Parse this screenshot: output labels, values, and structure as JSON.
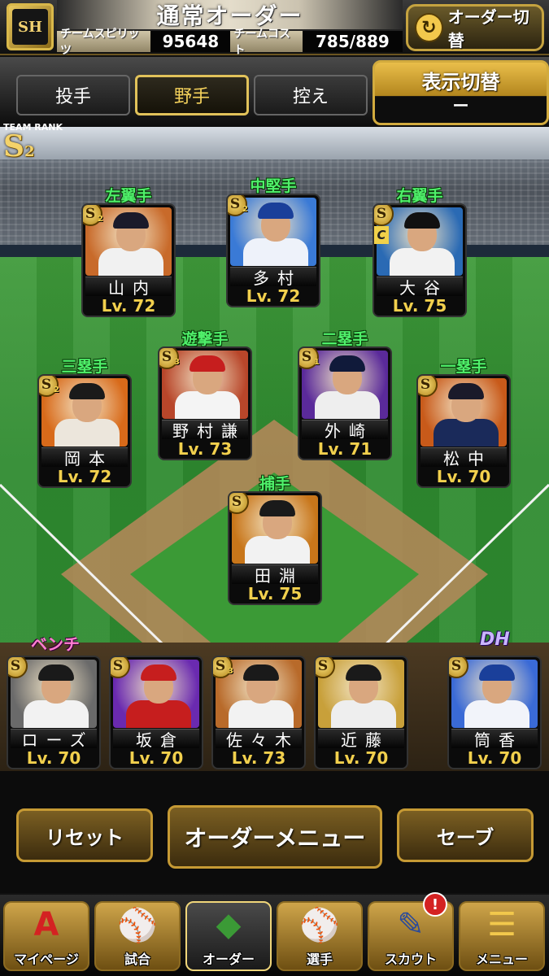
{
  "header": {
    "logo_text": "SH",
    "title": "通常オーダー",
    "spirits_label": "チームスピリッツ",
    "spirits_value": "95648",
    "cost_label": "チームコスト",
    "cost_value": "785/889",
    "order_switch_label": "オーダー切替"
  },
  "tabs": [
    {
      "label": "投手"
    },
    {
      "label": "野手"
    },
    {
      "label": "控え"
    }
  ],
  "display_switch": {
    "title": "表示切替",
    "value": "ー"
  },
  "team_rank": {
    "label": "TEAM RANK",
    "rank": "S",
    "rank_sub": "2"
  },
  "lineup": [
    {
      "position": "左翼手",
      "name": "山内",
      "level": "Lv. 72",
      "badge": "S",
      "badge_sub": "2",
      "cap": "#1a1a2a",
      "jersey": "#f1f1f1",
      "bg": "#c86a2a"
    },
    {
      "position": "中堅手",
      "name": "多村",
      "level": "Lv. 72",
      "badge": "S",
      "badge_sub": "2",
      "cap": "#1a3f9a",
      "jersey": "#eef2fa",
      "bg": "#3a7ad6"
    },
    {
      "position": "右翼手",
      "name": "大谷",
      "level": "Lv. 75",
      "badge": "S",
      "badge_sub": "",
      "cap": "#111111",
      "jersey": "#f2f2f2",
      "bg": "#2a6ab4"
    },
    {
      "position": "遊撃手",
      "name": "野村謙",
      "level": "Lv. 73",
      "badge": "S",
      "badge_sub": "3",
      "cap": "#c61e1e",
      "jersey": "#f4f4f4",
      "bg": "#b8462a"
    },
    {
      "position": "二塁手",
      "name": "外崎",
      "level": "Lv. 71",
      "badge": "S",
      "badge_sub": "1",
      "cap": "#101a3a",
      "jersey": "#eeeeee",
      "bg": "#5a2a9a"
    },
    {
      "position": "三塁手",
      "name": "岡本",
      "level": "Lv. 72",
      "badge": "S",
      "badge_sub": "2",
      "cap": "#1a1a1a",
      "jersey": "#ece6dc",
      "bg": "#d86a1a"
    },
    {
      "position": "一塁手",
      "name": "松中",
      "level": "Lv. 70",
      "badge": "S",
      "badge_sub": "",
      "cap": "#1a1a2a",
      "jersey": "#1a2a5a",
      "bg": "#c85a1a"
    },
    {
      "position": "捕手",
      "name": "田淵",
      "level": "Lv. 75",
      "badge": "S",
      "badge_sub": "",
      "cap": "#1a1a1a",
      "jersey": "#f2f2f2",
      "bg": "#c8761a"
    }
  ],
  "bench": {
    "label": "ベンチ",
    "dh_label": "DH",
    "players": [
      {
        "name": "ローズ",
        "level": "Lv. 70",
        "badge": "S",
        "badge_sub": "",
        "cap": "#1a1a1a",
        "jersey": "#f2f2f2",
        "bg": "#6a6a6a"
      },
      {
        "name": "坂倉",
        "level": "Lv. 70",
        "badge": "S",
        "badge_sub": "",
        "cap": "#c61e1e",
        "jersey": "#c61e1e",
        "bg": "#6a2ab0"
      },
      {
        "name": "佐々木",
        "level": "Lv. 73",
        "badge": "S",
        "badge_sub": "3",
        "cap": "#1a1a1a",
        "jersey": "#f2f2f2",
        "bg": "#b86a2a"
      },
      {
        "name": "近藤",
        "level": "Lv. 70",
        "badge": "S",
        "badge_sub": "",
        "cap": "#1a1a1a",
        "jersey": "#eeeeee",
        "bg": "#c8a03a"
      },
      {
        "name": "筒香",
        "level": "Lv. 70",
        "badge": "S",
        "badge_sub": "",
        "cap": "#1a3f9a",
        "jersey": "#f2f4fa",
        "bg": "#3a6ad6"
      }
    ]
  },
  "actions": {
    "reset": "リセット",
    "order_menu": "オーダーメニュー",
    "save": "セーブ"
  },
  "nav": [
    {
      "label": "マイページ",
      "icon": "A"
    },
    {
      "label": "試合",
      "icon": "⚾"
    },
    {
      "label": "オーダー",
      "icon": "◆"
    },
    {
      "label": "選手",
      "icon": "⚾"
    },
    {
      "label": "スカウト",
      "icon": "✎"
    },
    {
      "label": "メニュー",
      "icon": "☰"
    }
  ],
  "notification_badge": "!"
}
